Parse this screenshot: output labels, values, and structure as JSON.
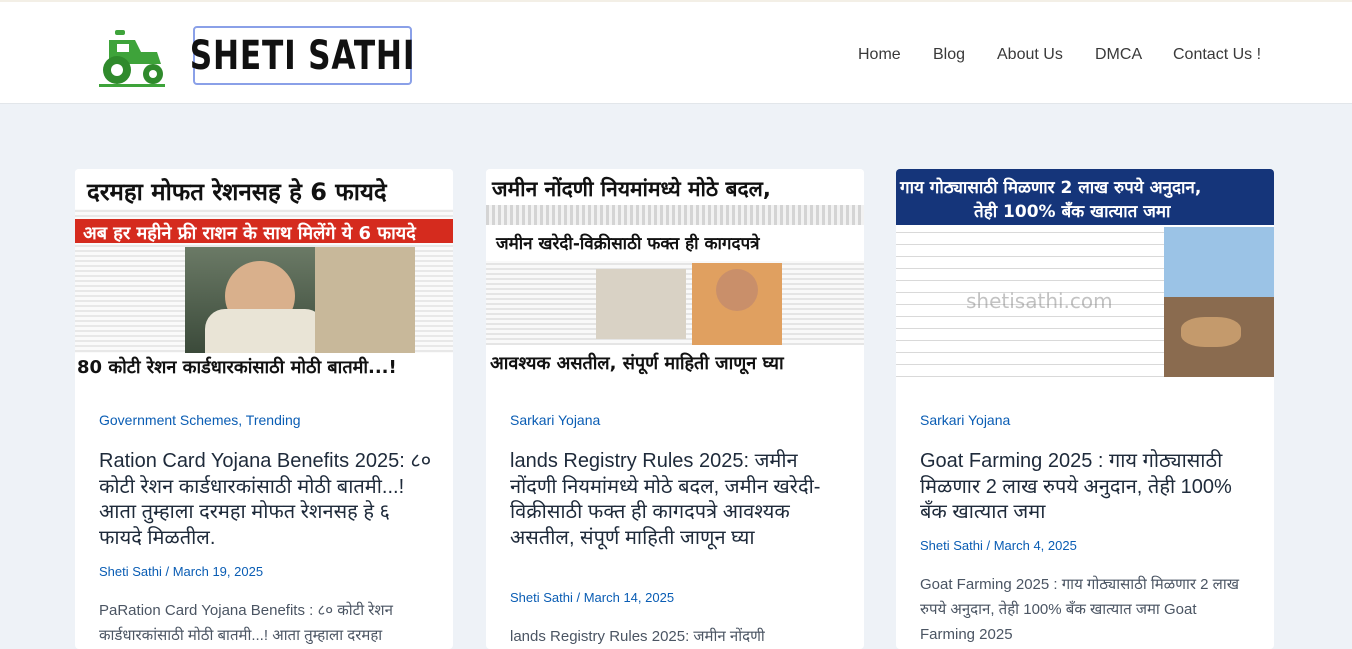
{
  "site": {
    "logo_text": "SHETI SATHI"
  },
  "nav": {
    "items": [
      "Home",
      "Blog",
      "About Us",
      "DMCA",
      "Contact Us !"
    ]
  },
  "posts": [
    {
      "thumb_top": "दरमहा मोफत रेशनसह हे 6 फायदे",
      "thumb_mid": "अब हर महीने फ्री राशन के साथ मिलेंगे ये 6 फायदे",
      "thumb_bottom": "80 कोटी रेशन कार्डधारकांसाठी मोठी बातमी...!",
      "categories": "Government Schemes, Trending",
      "title": "Ration Card Yojana Benefits 2025: ८० कोटी रेशन कार्डधारकांसाठी मोठी बातमी...! आता तुम्हाला दरमहा मोफत रेशनसह हे ६ फायदे मिळतील.",
      "meta": "Sheti Sathi / March 19, 2025",
      "excerpt": "PaRation Card Yojana Benefits : ८० कोटी रेशन कार्डधारकांसाठी मोठी बातमी...! आता तुम्हाला दरमहा"
    },
    {
      "thumb_top": "जमीन नोंदणी नियमांमध्ये मोठे बदल,",
      "thumb_mid": "जमीन खरेदी-विक्रीसाठी फक्त ही कागदपत्रे",
      "thumb_bottom": "आवश्यक असतील, संपूर्ण माहिती जाणून घ्या",
      "categories": "Sarkari Yojana",
      "title": "lands Registry Rules 2025: जमीन नोंदणी नियमांमध्ये मोठे बदल, जमीन खरेदी-विक्रीसाठी फक्त ही कागदपत्रे आवश्यक असतील, संपूर्ण माहिती जाणून घ्या",
      "meta": "Sheti Sathi / March 14, 2025",
      "excerpt": "lands Registry Rules 2025: जमीन नोंदणी"
    },
    {
      "thumb_top": "गाय गोठ्यासाठी मिळणार 2 लाख रुपये अनुदान,",
      "thumb_mid": "तेही 100% बँक खात्यात जमा",
      "thumb_watermark": "shetisathi.com",
      "categories": "Sarkari Yojana",
      "title": "Goat Farming 2025 :  गाय गोठ्यासाठी मिळणार 2 लाख रुपये अनुदान, तेही 100% बँक खात्यात जमा",
      "meta": "Sheti Sathi / March 4, 2025",
      "excerpt": "Goat Farming 2025 :  गाय गोठ्यासाठी मिळणार 2 लाख रुपये अनुदान, तेही 100% बँक खात्यात जमा Goat Farming 2025"
    }
  ],
  "colors": {
    "accent": "#0a5db4",
    "page_bg": "#eef2f7",
    "logo_green": "#3ea33a"
  },
  "icons": {
    "logo": "tractor-icon"
  }
}
